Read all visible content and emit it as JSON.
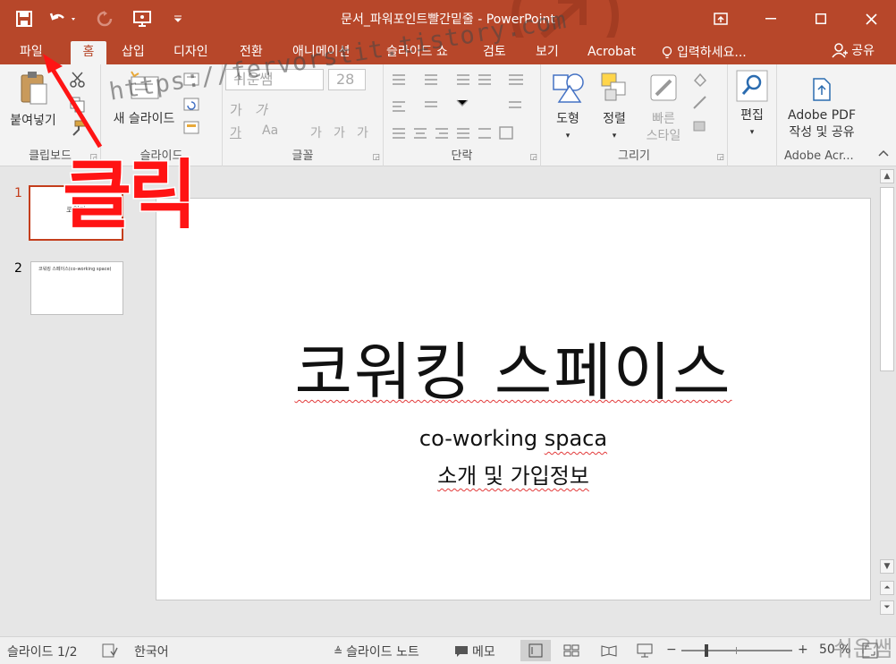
{
  "window": {
    "title": "문서_파워포인트빨간밑줄 - PowerPoint"
  },
  "tabs": {
    "file": "파일",
    "home": "홈",
    "insert": "삽입",
    "design": "디자인",
    "transitions": "전환",
    "animations": "애니메이션",
    "slideshow": "슬라이드 쇼",
    "review": "검토",
    "view": "보기",
    "acrobat": "Acrobat",
    "tellme": "입력하세요...",
    "share": "공유"
  },
  "ribbon": {
    "paste_label": "붙여넣기",
    "new_slide_label": "새 슬라이드",
    "font_name": "쉬운쌤",
    "font_size": "28",
    "shapes_label": "도형",
    "arrange_label": "정렬",
    "quick_styles_line1": "빠른",
    "quick_styles_line2": "스타일",
    "editing_label": "편집",
    "adobe_line1": "Adobe PDF",
    "adobe_line2": "작성 및 공유",
    "groups": {
      "clipboard": "클립보드",
      "slides": "슬라이드",
      "font": "글꼴",
      "paragraph": "단락",
      "drawing": "그리기",
      "adobe": "Adobe Acr..."
    },
    "font_glyphs": {
      "bold": "가",
      "italic": "가",
      "size_up": "가",
      "size_down": "가",
      "aa": "Aa"
    }
  },
  "slides_pane": {
    "items": [
      {
        "number": "1",
        "thumb_text": "코워킹"
      },
      {
        "number": "2",
        "thumb_text": "코워킹 스페이스(co-working space)"
      }
    ]
  },
  "slide": {
    "title": "코워킹 스페이스",
    "subtitle_line1": "co-working spaca",
    "subtitle_line2": "소개 및 가입정보"
  },
  "statusbar": {
    "slide_count": "슬라이드 1/2",
    "language": "한국어",
    "notes": "슬라이드 노트",
    "comments": "메모",
    "zoom_minus": "−",
    "zoom_plus": "+",
    "zoom_value": "50 %"
  },
  "overlay": {
    "watermark": "https://fervorstit.tistory.com",
    "click_label": "클릭",
    "signature": "쉬운쌤"
  },
  "colors": {
    "accent": "#b7472a",
    "annotation_red": "#ff1414"
  }
}
